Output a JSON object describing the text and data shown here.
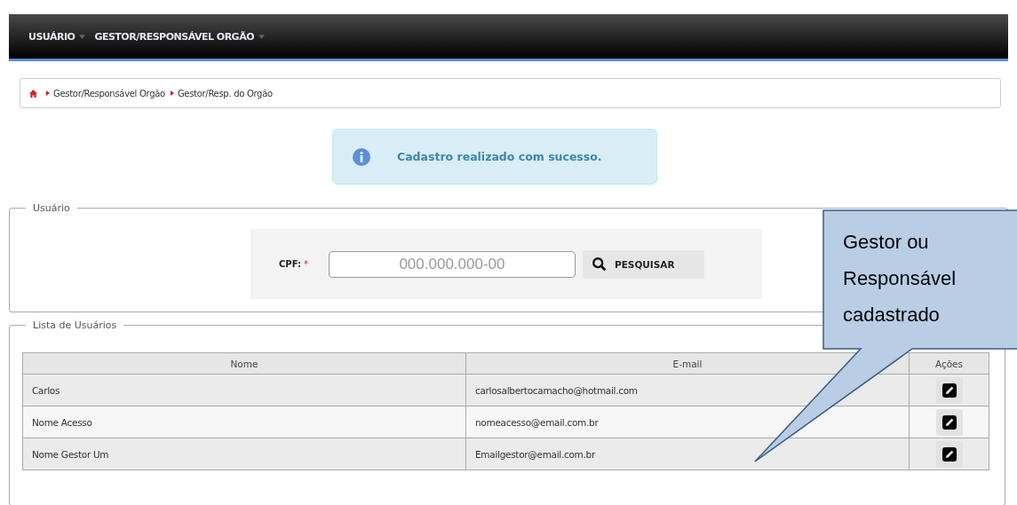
{
  "menu": [
    {
      "label": "USUÁRIO"
    },
    {
      "label": "GESTOR/RESPONSÁVEL ORGÃO"
    }
  ],
  "breadcrumb": [
    "Gestor/Responsável Orgão",
    "Gestor/Resp. do Orgão"
  ],
  "alert": {
    "kind": "info",
    "message": "Cadastro realizado com sucesso."
  },
  "user_section": {
    "legend": "Usuário",
    "cpf_label": "CPF:",
    "required_mark": "*",
    "placeholder": "000.000.000-00",
    "search_button": "PESQUISAR"
  },
  "list_section": {
    "legend": "Lista de Usuários",
    "columns": [
      "Nome",
      "E-mail",
      "Ações"
    ],
    "rows": [
      {
        "name": "Carlos",
        "email": "carlosalbertocamacho@hotmail.com"
      },
      {
        "name": "Nome Acesso",
        "email": "nomeacesso@email.com.br"
      },
      {
        "name": "Nome Gestor Um",
        "email": "Emailgestor@email.com.br"
      }
    ]
  },
  "callout": {
    "lines": [
      "Gestor ou",
      "Responsável",
      "cadastrado"
    ]
  }
}
